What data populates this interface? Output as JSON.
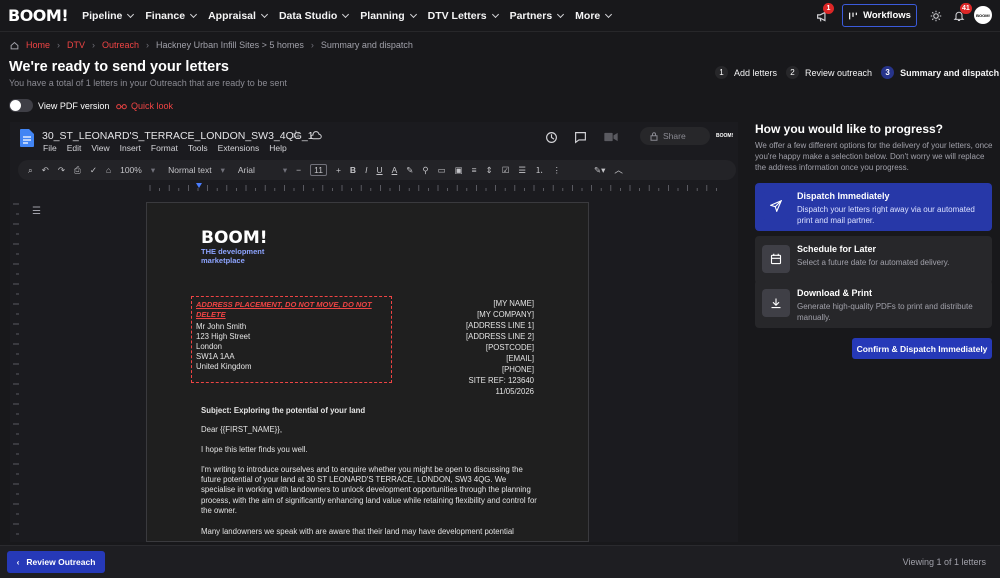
{
  "brand": {
    "logo": "BOOM!"
  },
  "nav": {
    "items": [
      "Pipeline",
      "Finance",
      "Appraisal",
      "Data Studio",
      "Planning",
      "DTV Letters",
      "Partners",
      "More"
    ]
  },
  "header": {
    "notifications_badge": "1",
    "alerts_badge": "41",
    "workflows_label": "Workflows",
    "avatar_text": "BOOM!"
  },
  "breadcrumb": {
    "home": "Home",
    "dtv": "DTV",
    "outreach": "Outreach",
    "site": "Hackney Urban Infill Sites > 5 homes",
    "current": "Summary and dispatch"
  },
  "page": {
    "title": "We're ready to send your letters",
    "subtitle": "You have a total of 1 letters in your Outreach that are ready to be sent"
  },
  "steps": [
    {
      "num": "1",
      "label": "Add letters"
    },
    {
      "num": "2",
      "label": "Review outreach"
    },
    {
      "num": "3",
      "label": "Summary and dispatch"
    }
  ],
  "controls": {
    "pdf_label": "View PDF version",
    "quick_look": "Quick look"
  },
  "doc": {
    "filename": "30_ST_LEONARD'S_TERRACE_LONDON_SW3_4QG_1",
    "menu": [
      "File",
      "Edit",
      "View",
      "Insert",
      "Format",
      "Tools",
      "Extensions",
      "Help"
    ],
    "share_label": "Share",
    "zoom": "100%",
    "style": "Normal text",
    "font": "Arial",
    "font_size": "11"
  },
  "letter": {
    "logo": "BOOM!",
    "tagline1": "THE development",
    "tagline2": "marketplace",
    "address_warning": "ADDRESS PLACEMENT, DO NOT MOVE, DO NOT DELETE",
    "recipient": [
      "Mr John Smith",
      "123 High Street",
      "London",
      "SW1A 1AA",
      "United Kingdom"
    ],
    "sender": [
      "[MY NAME]",
      "[MY COMPANY]",
      "[ADDRESS LINE 1]",
      "[ADDRESS LINE 2]",
      "[POSTCODE]",
      "[EMAIL]",
      "[PHONE]",
      "SITE REF: 123640",
      "11/05/2026"
    ],
    "subject": "Subject: Exploring the potential of your land",
    "greeting": "Dear {{FIRST_NAME}},",
    "p1": "I hope this letter finds you well.",
    "p2": "I'm writing to introduce ourselves and to enquire whether you might be open to discussing the future potential of your land at 30 ST LEONARD'S TERRACE, LONDON, SW3 4QG. We specialise in working with landowners to unlock development opportunities through the planning process, with the aim of significantly enhancing land value while retaining flexibility and control for the owner.",
    "p3": "Many landowners we speak with are aware that their land may have development potential"
  },
  "progress": {
    "title": "How you would like to progress?",
    "description": "We offer a few different options for the delivery of your letters, once you're happy make a selection below. Don't worry we will replace the address information once you progress.",
    "options": [
      {
        "title": "Dispatch Immediately",
        "desc": "Dispatch your letters right away via our automated print and mail partner."
      },
      {
        "title": "Schedule for Later",
        "desc": "Select a future date for automated delivery."
      },
      {
        "title": "Download & Print",
        "desc": "Generate high-quality PDFs to print and distribute manually."
      }
    ],
    "confirm_label": "Confirm & Dispatch Immediately"
  },
  "footer": {
    "review_label": "Review Outreach",
    "viewing": "Viewing 1 of 1 letters"
  },
  "colors": {
    "accent": "#2639b8",
    "link": "#ef4444"
  }
}
